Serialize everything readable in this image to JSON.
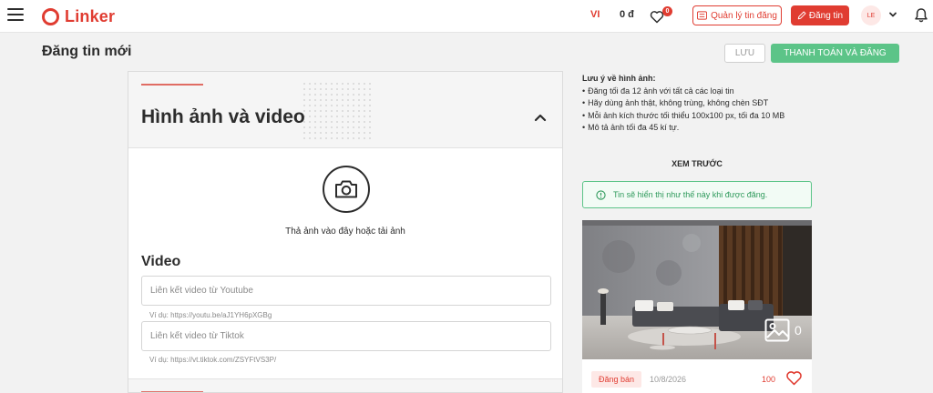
{
  "header": {
    "brand": "Linker",
    "language": "VI",
    "balance": "0 đ",
    "favorites_count": "0",
    "manage_label": "Quản lý tin đăng",
    "post_label": "Đăng tin",
    "avatar_initials": "LE",
    "icons": [
      "menu-icon",
      "heart-icon",
      "list-icon",
      "pencil-icon",
      "chevron-down-icon",
      "bell-icon"
    ]
  },
  "page": {
    "title": "Đăng tin mới",
    "save_label": "LƯU",
    "pay_label": "THANH TOÁN VÀ ĐĂNG"
  },
  "media": {
    "title": "Hình ảnh và video",
    "upload_text": "Thả ảnh vào đây hoặc tải ảnh",
    "video_title": "Video",
    "youtube_placeholder": "Liên kết video từ Youtube",
    "youtube_hint": "Ví dụ: https://youtu.be/aJ1YH6pXGBg",
    "tiktok_placeholder": "Liên kết video từ Tiktok",
    "tiktok_hint": "Ví dụ: https://vt.tiktok.com/ZSYFtVS3P/"
  },
  "notes": {
    "title": "Lưu ý về hình ảnh:",
    "items": [
      "Đăng tối đa 12 ảnh với tất cả các loại tin",
      "Hãy dùng ảnh thật, không trùng, không chèn SĐT",
      "Mỗi ảnh kích thước tối thiểu 100x100 px, tối đa 10 MB",
      "Mô tả ảnh tối đa 45 kí tự."
    ]
  },
  "preview": {
    "title": "XEM TRƯỚC",
    "info": "Tin sẽ hiển thị như thế này khi được đăng.",
    "image_count": "0",
    "tag": "Đăng bán",
    "date": "10/8/2026",
    "likes": "100"
  },
  "colors": {
    "brand": "#e03c31",
    "success": "#5cc488"
  }
}
